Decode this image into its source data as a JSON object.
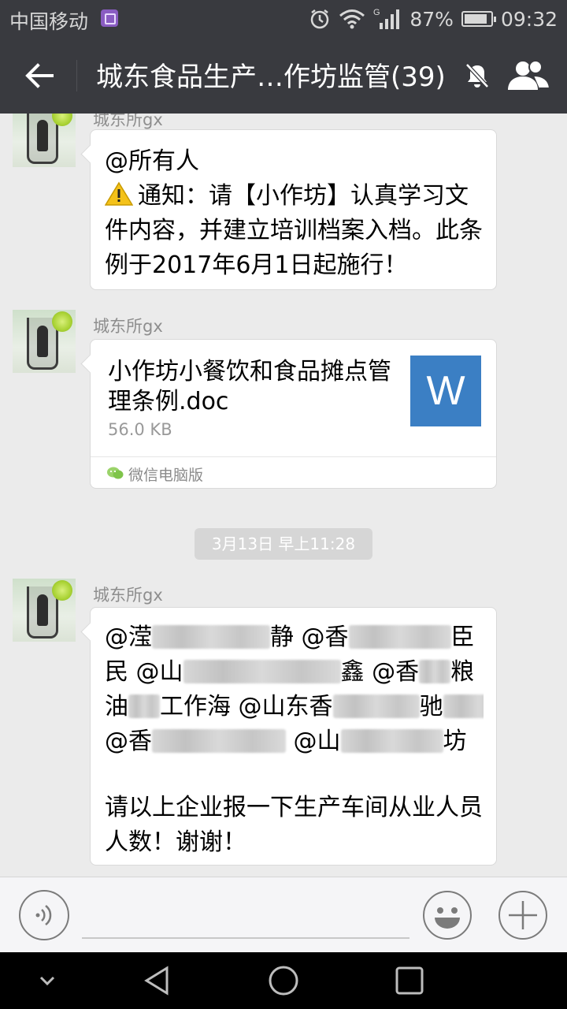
{
  "status_bar": {
    "carrier": "中国移动",
    "battery_percent": "87%",
    "battery_level": 0.87,
    "time": "09:32",
    "network_label": "G"
  },
  "title_bar": {
    "title": "城东食品生产…作坊监管(39)"
  },
  "messages": [
    {
      "sender": "城东所gx",
      "mention": "@所有人",
      "body": "通知：请【小作坊】认真学习文件内容，并建立培训档案入档。此条例于2017年6月1日起施行！"
    },
    {
      "sender": "城东所gx",
      "file_name": "小作坊小餐饮和食品摊点管理条例.doc",
      "file_size": "56.0 KB",
      "file_type_letter": "W",
      "source": "微信电脑版"
    },
    {
      "timestamp": "3月13日 早上11:28"
    },
    {
      "sender": "城东所gx",
      "mentions_partial": [
        "@滢",
        "静 @香",
        "臣",
        "民 @山",
        "鑫",
        "@香",
        "粮",
        "油",
        "工",
        "作",
        "海 @山东香",
        "驰",
        "坊",
        "@香",
        "@山",
        "坊"
      ],
      "body": "请以上企业报一下生产车间从业人员人数！谢谢！"
    }
  ],
  "input": {
    "placeholder": ""
  },
  "colors": {
    "header_bg": "#393a3f",
    "chat_bg": "#ebebeb",
    "file_icon_bg": "#3b7fc4"
  }
}
